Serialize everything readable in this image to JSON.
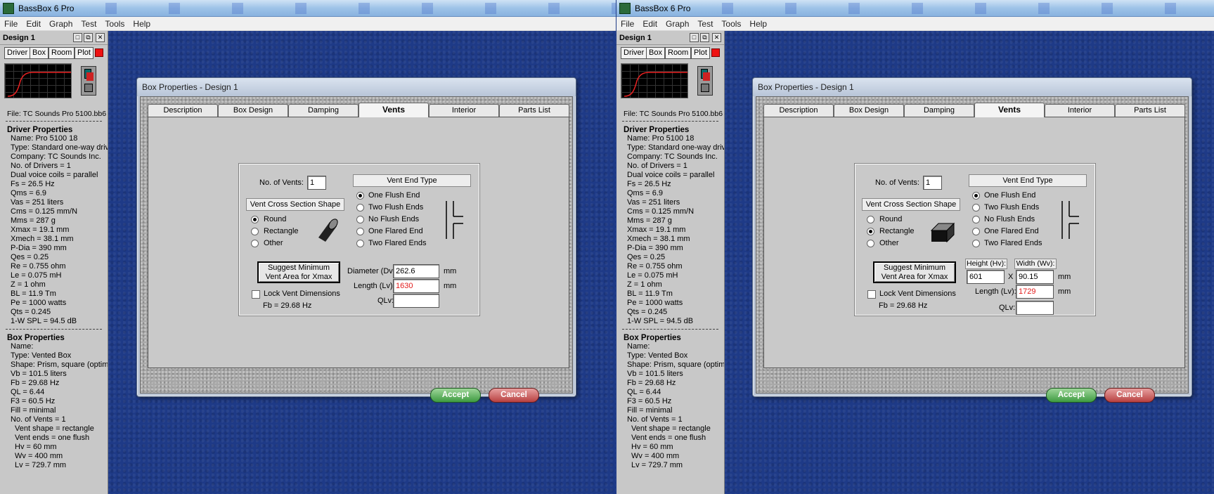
{
  "app": {
    "title": "BassBox 6 Pro"
  },
  "menu": [
    "File",
    "Edit",
    "Graph",
    "Test",
    "Tools",
    "Help"
  ],
  "sidebar": {
    "design_title": "Design 1",
    "win_buttons": [
      "□",
      "⧉",
      "✕"
    ],
    "tool_buttons": [
      "Driver",
      "Box",
      "Room",
      "Plot"
    ],
    "file": "File: TC Sounds Pro 5100.bb6",
    "separator": "-------------------------------",
    "driver_title": "Driver Properties",
    "driver_props": [
      "Name: Pro 5100 18",
      "Type: Standard one-way driver",
      "Company: TC Sounds Inc.",
      "No. of Drivers = 1",
      "Dual voice coils = parallel",
      "Fs =  26.5 Hz",
      "Qms =  6.9",
      "Vas =  251 liters",
      "Cms =  0.125 mm/N",
      "Mms =  287 g",
      "Xmax =  19.1 mm",
      "Xmech =  38.1 mm",
      "P-Dia =  390 mm",
      "Qes =  0.25",
      "Re =  0.755 ohm",
      "Le =  0.075 mH",
      "Z =  1 ohm",
      "BL =  11.9 Tm",
      "Pe =  1000 watts",
      "Qts =  0.245",
      "1-W SPL =  94.5 dB"
    ],
    "box_title": "Box Properties",
    "box_props": [
      "Name:",
      "Type: Vented Box",
      "Shape: Prism, square (optimum)",
      "Vb =  101.5 liters",
      "Fb =  29.68 Hz",
      "QL =  6.44",
      "F3 =  60.5 Hz",
      "Fill = minimal",
      "No. of Vents = 1"
    ],
    "box_props_indented": [
      "Vent shape = rectangle",
      "Vent ends = one flush",
      "Hv =  60 mm",
      "Wv =  400 mm",
      "Lv =  729.7 mm"
    ]
  },
  "dialog": {
    "title": "Box Properties - Design 1",
    "tabs": [
      "Description",
      "Box Design",
      "Damping",
      "Vents",
      "Interior",
      "Parts List"
    ],
    "active_tab": "Vents",
    "no_vents_label": "No. of Vents:",
    "no_vents_value": "1",
    "vent_end_type_title": "Vent End Type",
    "vent_end_options": [
      "One Flush End",
      "Two Flush Ends",
      "No Flush Ends",
      "One Flared End",
      "Two Flared Ends"
    ],
    "cross_section_title": "Vent Cross Section Shape",
    "shape_options": [
      "Round",
      "Rectangle",
      "Other"
    ],
    "suggest_button": [
      "Suggest Minimum",
      "Vent Area for Xmax"
    ],
    "lock_label": "Lock Vent Dimensions",
    "fb_label": "Fb = 29.68 Hz",
    "qlv_label": "QLv:",
    "mm": "mm",
    "x": "X",
    "accept": "Accept",
    "cancel": "Cancel"
  },
  "left_dialog": {
    "selected_shape": "Round",
    "diameter_label": "Diameter (Dv):",
    "diameter_value": "262.6",
    "length_label": "Length (Lv):",
    "length_value": "1630"
  },
  "right_dialog": {
    "selected_shape": "Rectangle",
    "height_label": "Height (Hv):",
    "height_value": "601",
    "width_label": "Width (Wv):",
    "width_value": "90.15",
    "length_label": "Length (Lv):",
    "length_value": "1729"
  },
  "colors": {
    "length_value": "#e21a1a",
    "accept": "#3e9b41",
    "cancel": "#b84141",
    "desktop": "#1e3a87"
  }
}
